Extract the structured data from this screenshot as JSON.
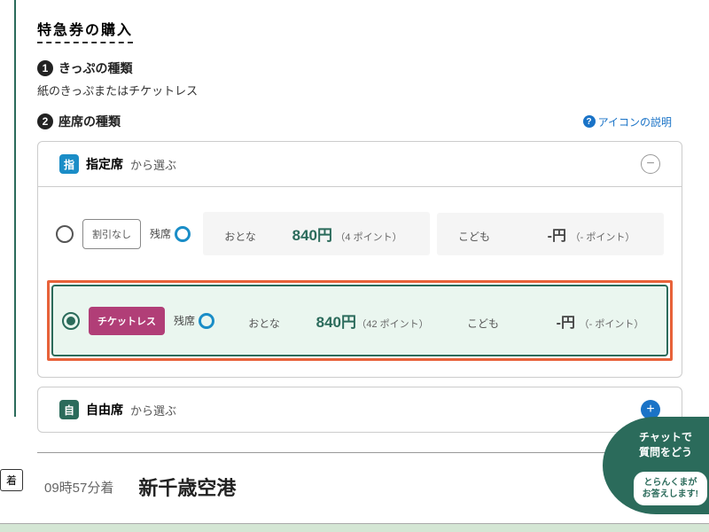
{
  "title": "特急券の購入",
  "step1": {
    "num": "1",
    "label": "きっぷの種類",
    "desc": "紙のきっぷまたはチケットレス"
  },
  "step2": {
    "num": "2",
    "label": "座席の種類"
  },
  "iconHelp": "アイコンの説明",
  "reserved": {
    "badge": "指",
    "label": "指定席",
    "sublabel": "から選ぶ"
  },
  "free": {
    "badge": "自",
    "label": "自由席",
    "sublabel": "から選ぶ"
  },
  "remainLabel": "残席",
  "options": {
    "opt1": {
      "tag": "割引なし",
      "adultLabel": "おとな",
      "adultPrice": "840円",
      "adultPoints": "（4 ポイント）",
      "childLabel": "こども",
      "childPrice": "-円",
      "childPoints": "（- ポイント）"
    },
    "opt2": {
      "tag": "チケットレス",
      "adultLabel": "おとな",
      "adultPrice": "840円",
      "adultPoints": "（42 ポイント）",
      "childLabel": "こども",
      "childPrice": "-円",
      "childPoints": "（- ポイント）"
    }
  },
  "arrival": {
    "badge": "着",
    "time": "09時57分着",
    "station": "新千歳空港"
  },
  "chat": {
    "line1": "チャットで",
    "line2": "質問をどう",
    "say1": "とらんくまが",
    "say2": "お答えします!"
  }
}
